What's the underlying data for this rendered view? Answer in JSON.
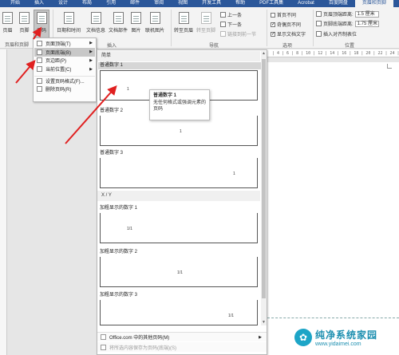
{
  "tabs": [
    "开始",
    "插入",
    "设计",
    "布局",
    "引用",
    "邮件",
    "审阅",
    "视图",
    "开发工具",
    "帮助",
    "PDF工具集",
    "Acrobat",
    "百度网盘",
    "页眉和页脚"
  ],
  "ribbon": {
    "header_btn": "页眉",
    "footer_btn": "页脚",
    "pagenum_btn": "页码",
    "datetime_btn": "日期和时间",
    "docinfo_btn": "文档信息",
    "docparts_btn": "文档部件",
    "picture_btn": "图片",
    "onlinepic_btn": "联机图片",
    "goto_header_btn": "转至页眉",
    "goto_footer_btn": "转至页脚",
    "prev_btn": "上一条",
    "next_btn": "下一条",
    "link_prev_btn": "链接到前一节",
    "diff_first": "首页不同",
    "diff_oddeven": "奇偶页不同",
    "show_doc_text": "显示文档文字",
    "header_top_label": "页眉顶端距离:",
    "header_top_value": "1.5 厘米",
    "footer_bottom_label": "页脚底端距离:",
    "footer_bottom_value": "1.75 厘米",
    "insert_align_tab": "插入对齐制表位",
    "group_header_footer": "页眉和页脚",
    "group_insert": "插入",
    "group_nav": "导航",
    "group_options": "选项",
    "group_position": "位置"
  },
  "menu": {
    "items": [
      "页面顶端(T)",
      "页面底端(B)",
      "页边距(P)",
      "当前位置(C)",
      "设置页码格式(F)...",
      "删除页码(R)"
    ]
  },
  "gallery": {
    "section_simple": "简单",
    "section_xy": "X / Y",
    "items": [
      {
        "title": "普通数字 1",
        "num": "1"
      },
      {
        "title": "普通数字 2",
        "num": "1"
      },
      {
        "title": "普通数字 3",
        "num": "1"
      },
      {
        "title": "加粗显示的数字 1",
        "num": "1/1"
      },
      {
        "title": "加粗显示的数字 2",
        "num": "1/1"
      },
      {
        "title": "加粗显示的数字 3",
        "num": "1/1"
      }
    ],
    "more_office": "Office.com 中的其他页码(M)",
    "save_selection": "将所选内容保存为页码(底端)(S)"
  },
  "tooltip": {
    "title": "普通数字 1",
    "body": "无任何格式或强调元素的页码"
  },
  "ruler_text": "| 4 | 6 | 8 | 10 | 12 | 14 | 16 | 18 | 20 | 22 | 24 |",
  "watermark": {
    "title": "纯净系统家园",
    "url": "www.yidaimei.com"
  },
  "annotation_arrow_color": "#e02020"
}
